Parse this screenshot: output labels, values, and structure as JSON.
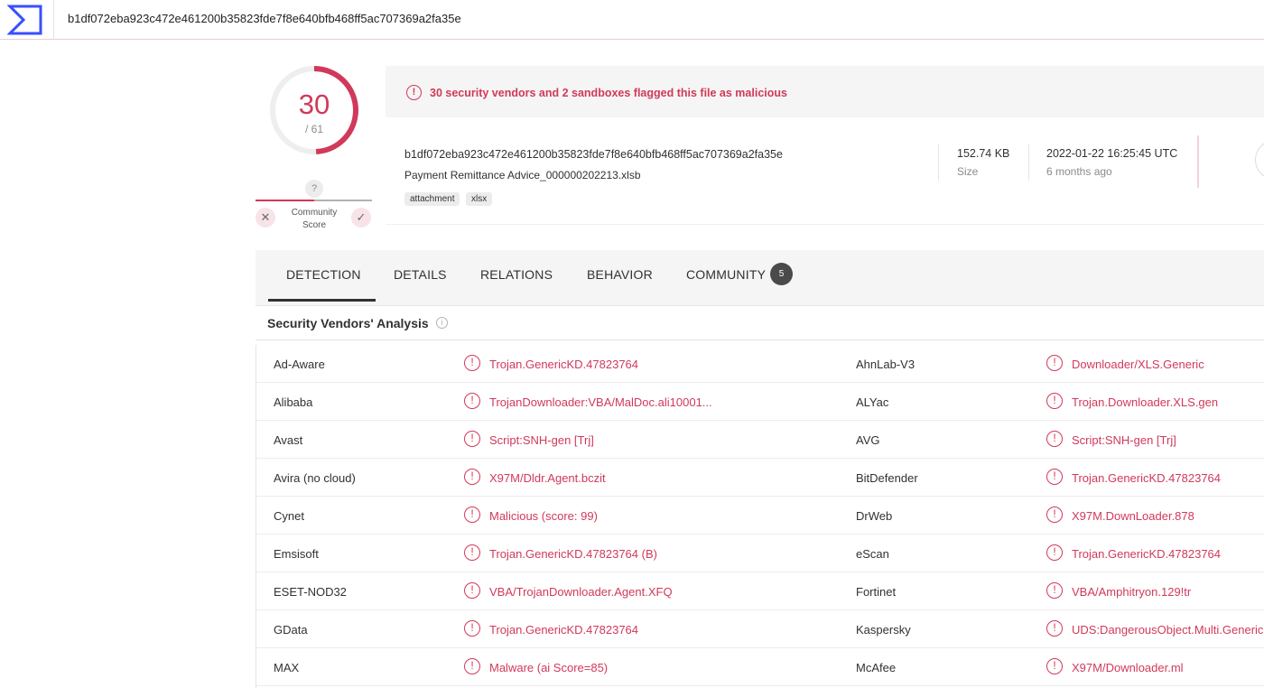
{
  "header": {
    "logo_icon": "virustotal-sigma-logo",
    "search_hash": "b1df072eba923c472e461200b35823fde7f8e640bfb468ff5ac707369a2fa35e"
  },
  "score": {
    "detections": "30",
    "total": "/ 61",
    "detection_fraction": 0.4918,
    "community_question": "?",
    "community_label": "Community Score",
    "downvote_icon": "x-icon",
    "upvote_icon": "check-icon"
  },
  "summary": {
    "alert_icon": "!",
    "alert_text": "30 security vendors and 2 sandboxes flagged this file as malicious",
    "file_hash": "b1df072eba923c472e461200b35823fde7f8e640bfb468ff5ac707369a2fa35e",
    "file_name": "Payment Remittance Advice_000000202213.xlsb",
    "tags": [
      "attachment",
      "xlsx"
    ],
    "size_value": "152.74 KB",
    "size_label": "Size",
    "date_value": "2022-01-22 16:25:45 UTC",
    "date_label": "6 months ago"
  },
  "tabs": [
    {
      "label": "DETECTION",
      "active": true
    },
    {
      "label": "DETAILS"
    },
    {
      "label": "RELATIONS"
    },
    {
      "label": "BEHAVIOR"
    },
    {
      "label": "COMMUNITY",
      "badge": "5"
    }
  ],
  "analysis": {
    "title": "Security Vendors' Analysis",
    "info_icon": "i",
    "alert_glyph": "!",
    "rows": [
      {
        "left_vendor": "Ad-Aware",
        "left_result": "Trojan.GenericKD.47823764",
        "right_vendor": "AhnLab-V3",
        "right_result": "Downloader/XLS.Generic"
      },
      {
        "left_vendor": "Alibaba",
        "left_result": "TrojanDownloader:VBA/MalDoc.ali10001...",
        "right_vendor": "ALYac",
        "right_result": "Trojan.Downloader.XLS.gen"
      },
      {
        "left_vendor": "Avast",
        "left_result": "Script:SNH-gen [Trj]",
        "right_vendor": "AVG",
        "right_result": "Script:SNH-gen [Trj]"
      },
      {
        "left_vendor": "Avira (no cloud)",
        "left_result": "X97M/Dldr.Agent.bczit",
        "right_vendor": "BitDefender",
        "right_result": "Trojan.GenericKD.47823764"
      },
      {
        "left_vendor": "Cynet",
        "left_result": "Malicious (score: 99)",
        "right_vendor": "DrWeb",
        "right_result": "X97M.DownLoader.878"
      },
      {
        "left_vendor": "Emsisoft",
        "left_result": "Trojan.GenericKD.47823764 (B)",
        "right_vendor": "eScan",
        "right_result": "Trojan.GenericKD.47823764"
      },
      {
        "left_vendor": "ESET-NOD32",
        "left_result": "VBA/TrojanDownloader.Agent.XFQ",
        "right_vendor": "Fortinet",
        "right_result": "VBA/Amphitryon.129!tr"
      },
      {
        "left_vendor": "GData",
        "left_result": "Trojan.GenericKD.47823764",
        "right_vendor": "Kaspersky",
        "right_result": "UDS:DangerousObject.Multi.Generic"
      },
      {
        "left_vendor": "MAX",
        "left_result": "Malware (ai Score=85)",
        "right_vendor": "McAfee",
        "right_result": "X97M/Downloader.ml"
      }
    ]
  },
  "colors": {
    "accent": "#d1395a",
    "panel": "#f5f5f5",
    "text": "#313131",
    "muted": "#8a8a8a"
  }
}
